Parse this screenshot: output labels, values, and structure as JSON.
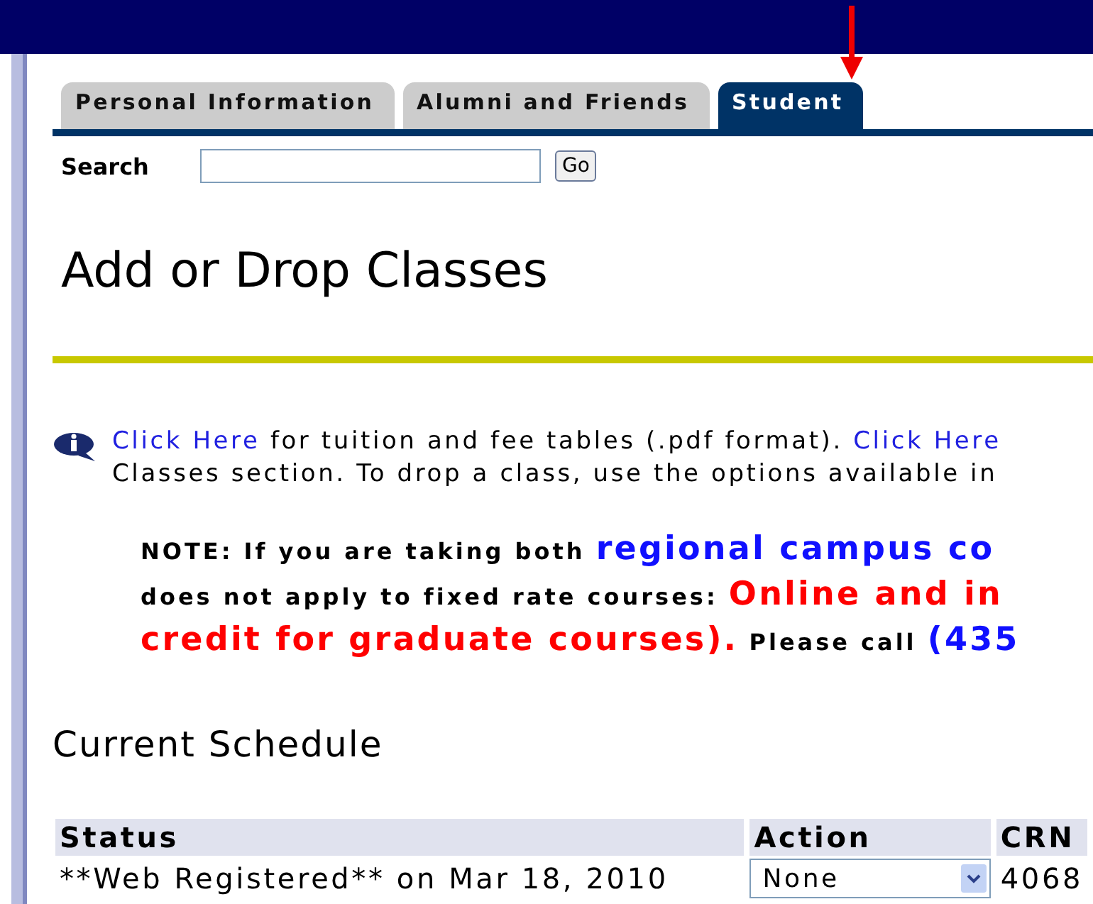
{
  "tabs": [
    {
      "label": "Personal Information",
      "selected": false
    },
    {
      "label": "Alumni and Friends",
      "selected": false
    },
    {
      "label": "Student",
      "selected": true
    }
  ],
  "search": {
    "label": "Search",
    "button": "Go"
  },
  "title": "Add or Drop Classes",
  "info_lines": [
    [
      {
        "kind": "link",
        "text": "Click Here"
      },
      {
        "kind": "plain",
        "text": " for tuition and fee tables (.pdf format). "
      },
      {
        "kind": "link",
        "text": "Click Here"
      }
    ],
    [
      {
        "kind": "plain",
        "text": "Classes section. To drop a class, use the options available in"
      }
    ]
  ],
  "note_lines": [
    [
      {
        "kind": "bold",
        "text": "NOTE: If you are taking both "
      },
      {
        "kind": "blue",
        "text": "regional campus co"
      }
    ],
    [
      {
        "kind": "bold",
        "text": "does not apply to fixed rate courses: "
      },
      {
        "kind": "red",
        "text": "Online and in"
      }
    ],
    [
      {
        "kind": "red",
        "text": "credit for graduate courses)."
      },
      {
        "kind": "bold",
        "text": " Please call "
      },
      {
        "kind": "blue",
        "text": "(435"
      }
    ]
  ],
  "schedule": {
    "title": "Current Schedule",
    "columns": [
      "Status",
      "Action",
      "CRN"
    ],
    "rows": [
      {
        "status": "**Web Registered** on Mar 18, 2010",
        "action": "None",
        "crn": "4068"
      }
    ]
  }
}
